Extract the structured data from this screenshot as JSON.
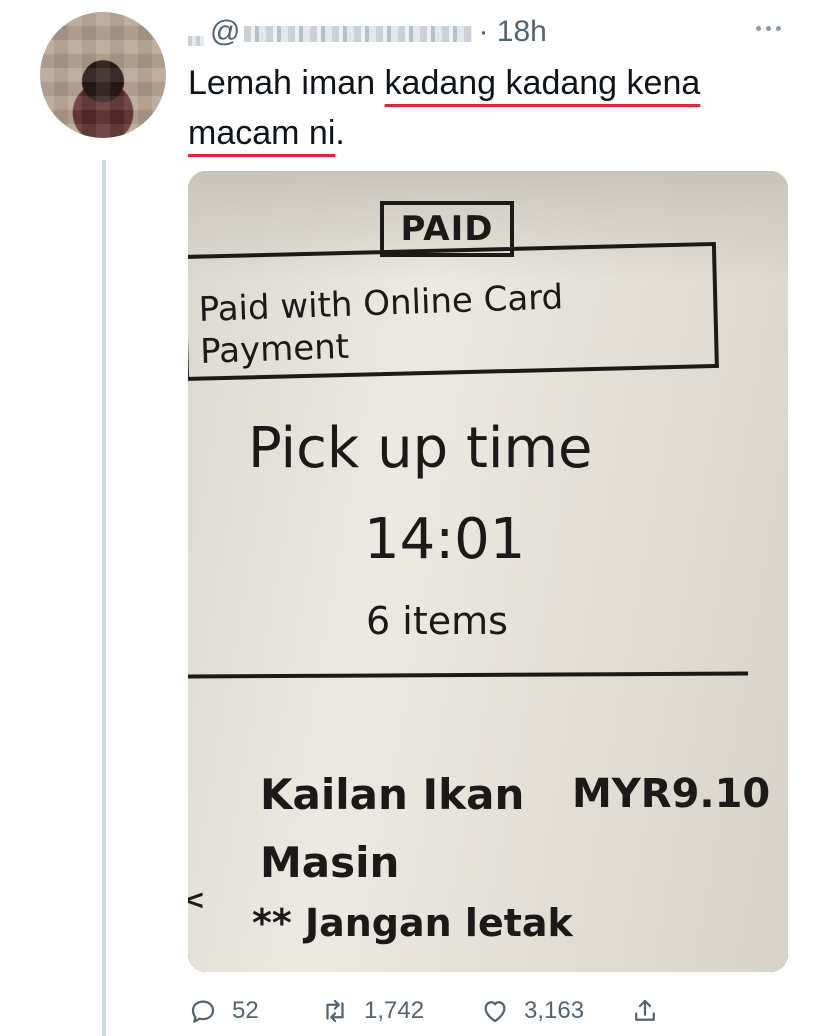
{
  "tweet": {
    "time": "18h",
    "handle_prefix": "@",
    "text_parts": {
      "p1": "Lemah iman ",
      "u1": "kadang kadang kena",
      "u2": "macam ni",
      "p2": "."
    }
  },
  "receipt": {
    "paid_stamp": "PAID",
    "paid_with_line1": "Paid with Online Card",
    "paid_with_line2": "Payment",
    "pickup_label": "Pick up time",
    "pickup_time": "14:01",
    "items_count": "6 items",
    "item_name_line1": "Kailan Ikan",
    "item_name_line2": "Masin",
    "item_price": "MYR9.10",
    "item_note": "** Jangan letak"
  },
  "actions": {
    "replies": "52",
    "retweets": "1,742",
    "likes": "3,163"
  },
  "icons": [
    "more-icon",
    "reply-icon",
    "retweet-icon",
    "like-icon",
    "share-icon"
  ],
  "colors": {
    "underline": "#e0263a",
    "muted": "#536471",
    "thread": "#cfd9de"
  }
}
